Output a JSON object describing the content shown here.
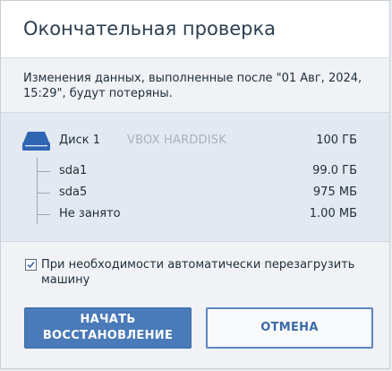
{
  "dialog": {
    "title": "Окончательная проверка",
    "warning": "Изменения данных, выполненные после \"01 Авг, 2024, 15:29\", будут потеряны."
  },
  "disk": {
    "name": "Диск 1",
    "model": "VBOX HARDDISK",
    "size": "100 ГБ",
    "icon": "hard-disk-icon",
    "partitions": [
      {
        "label": "sda1",
        "size": "99.0 ГБ"
      },
      {
        "label": "sda5",
        "size": "975 МБ"
      },
      {
        "label": "Не занято",
        "size": "1.00 МБ"
      }
    ]
  },
  "options": {
    "reboot_checked": true,
    "reboot_label": "При необходимости автоматически перезагрузить машину"
  },
  "buttons": {
    "start": "НАЧАТЬ ВОССТАНОВЛЕНИЕ",
    "cancel": "ОТМЕНА"
  },
  "colors": {
    "primary": "#4a7ab8",
    "panel": "#e3e9f1",
    "background": "#f0f2f5",
    "disk_icon": "#2f66b3"
  }
}
